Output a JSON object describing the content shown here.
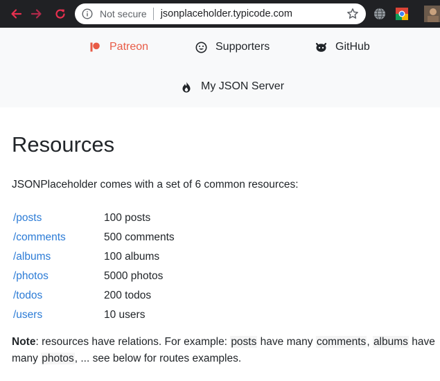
{
  "browser": {
    "security_label": "Not secure",
    "url": "jsonplaceholder.typicode.com",
    "icons": {
      "back": "arrow-left-icon",
      "forward": "arrow-right-icon",
      "reload": "reload-icon",
      "info": "info-icon",
      "bookmark": "star-icon"
    },
    "colors": {
      "chrome_bg": "#202124",
      "nav_arrow": "#e8304f"
    }
  },
  "topnav": {
    "links": [
      {
        "label": "Patreon",
        "icon": "patreon-icon",
        "color": "#e85b46"
      },
      {
        "label": "Supporters",
        "icon": "smile-icon"
      },
      {
        "label": "GitHub",
        "icon": "github-icon"
      },
      {
        "label": "My JSON Server",
        "icon": "flame-icon"
      }
    ]
  },
  "main": {
    "title": "Resources",
    "intro": "JSONPlaceholder comes with a set of 6 common resources:",
    "resources": [
      {
        "path": "/posts",
        "count": "100 posts"
      },
      {
        "path": "/comments",
        "count": "500 comments"
      },
      {
        "path": "/albums",
        "count": "100 albums"
      },
      {
        "path": "/photos",
        "count": "5000 photos"
      },
      {
        "path": "/todos",
        "count": "200 todos"
      },
      {
        "path": "/users",
        "count": "10 users"
      }
    ],
    "note": {
      "bold": "Note",
      "part1": ": resources have relations. For example: ",
      "code1": "posts",
      "part2": " have many ",
      "code2": "comments",
      "part3": ", ",
      "code3": "albums",
      "part4": " have many ",
      "code4": "photos",
      "part5": ", ... see below for routes examples."
    },
    "link_color": "#2b7bd6"
  }
}
